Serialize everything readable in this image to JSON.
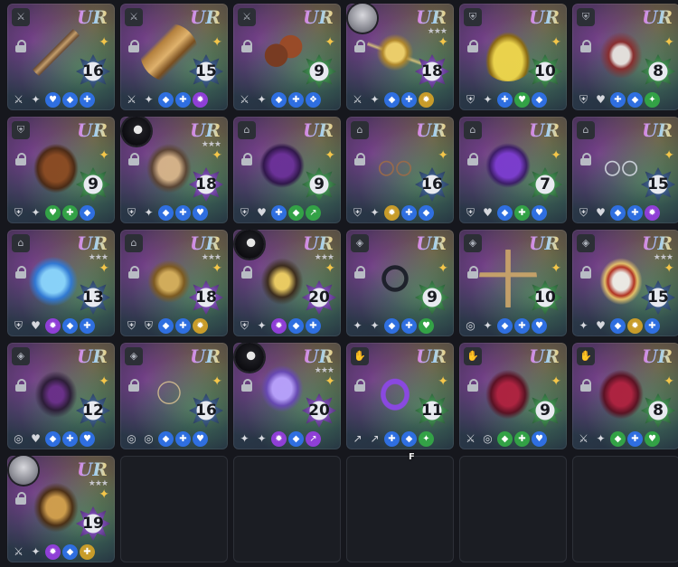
{
  "grade_label": "UR",
  "marker_label": "F",
  "rows": [
    [
      {
        "type_icon": "sword-icon",
        "avatar": null,
        "level": 16,
        "stars": "",
        "art": "art-staff",
        "badge": "blue",
        "stats": [
          [
            "plain",
            "⚔"
          ],
          [
            "plain",
            "✦"
          ],
          [
            "blue",
            "♥"
          ],
          [
            "blue",
            "◆"
          ],
          [
            "blue",
            "✚"
          ]
        ]
      },
      {
        "type_icon": "sword-icon",
        "avatar": null,
        "level": 15,
        "stars": "",
        "art": "art-crystal",
        "badge": "blue",
        "stats": [
          [
            "plain",
            "⚔"
          ],
          [
            "plain",
            "✦"
          ],
          [
            "blue",
            "◆"
          ],
          [
            "blue",
            "✚"
          ],
          [
            "purple",
            "✹"
          ]
        ]
      },
      {
        "type_icon": "sword-icon",
        "avatar": null,
        "level": 9,
        "stars": "",
        "art": "art-gloves",
        "badge": "green",
        "stats": [
          [
            "plain",
            "⚔"
          ],
          [
            "plain",
            "✦"
          ],
          [
            "blue",
            "◆"
          ],
          [
            "blue",
            "✚"
          ],
          [
            "blue",
            "❖"
          ]
        ]
      },
      {
        "type_icon": "sword-icon",
        "avatar": "light",
        "level": 18,
        "stars": "★★★",
        "art": "art-gold",
        "badge": "purple",
        "stats": [
          [
            "plain",
            "⚔"
          ],
          [
            "plain",
            "✦"
          ],
          [
            "blue",
            "◆"
          ],
          [
            "blue",
            "✚"
          ],
          [
            "gold",
            "✹"
          ]
        ]
      },
      {
        "type_icon": "armor-icon",
        "avatar": null,
        "level": 10,
        "stars": "",
        "art": "art-bell",
        "badge": "green",
        "stats": [
          [
            "plain",
            "⛨"
          ],
          [
            "plain",
            "✦"
          ],
          [
            "blue",
            "✚"
          ],
          [
            "green",
            "♥"
          ],
          [
            "blue",
            "◆"
          ]
        ]
      },
      {
        "type_icon": "armor-icon",
        "avatar": null,
        "level": 8,
        "stars": "",
        "art": "art-armor-w",
        "badge": "green",
        "stats": [
          [
            "plain",
            "⛨"
          ],
          [
            "plain",
            "♥"
          ],
          [
            "blue",
            "✚"
          ],
          [
            "blue",
            "◆"
          ],
          [
            "green",
            "✦"
          ]
        ]
      }
    ],
    [
      {
        "type_icon": "armor-icon",
        "avatar": null,
        "level": 9,
        "stars": "",
        "art": "art-armor-b",
        "badge": "green",
        "stats": [
          [
            "plain",
            "⛨"
          ],
          [
            "plain",
            "✦"
          ],
          [
            "green",
            "♥"
          ],
          [
            "green",
            "✚"
          ],
          [
            "blue",
            "◆"
          ]
        ]
      },
      {
        "type_icon": "armor-icon",
        "avatar": "dark",
        "level": 18,
        "stars": "★★★",
        "art": "art-armor-g",
        "badge": "purple",
        "stats": [
          [
            "plain",
            "⛨"
          ],
          [
            "plain",
            "✦"
          ],
          [
            "blue",
            "◆"
          ],
          [
            "blue",
            "✚"
          ],
          [
            "blue",
            "♥"
          ]
        ]
      },
      {
        "type_icon": "helmet-icon",
        "avatar": null,
        "level": 9,
        "stars": "",
        "art": "art-ribbon",
        "badge": "green",
        "stats": [
          [
            "plain",
            "⛨"
          ],
          [
            "plain",
            "♥"
          ],
          [
            "blue",
            "✚"
          ],
          [
            "green",
            "◆"
          ],
          [
            "green",
            "↗"
          ]
        ]
      },
      {
        "type_icon": "helmet-icon",
        "avatar": null,
        "level": 16,
        "stars": "",
        "art": "art-glasses",
        "badge": "blue",
        "stats": [
          [
            "plain",
            "⛨"
          ],
          [
            "plain",
            "✦"
          ],
          [
            "gold",
            "✹"
          ],
          [
            "blue",
            "✚"
          ],
          [
            "blue",
            "◆"
          ]
        ]
      },
      {
        "type_icon": "helmet-icon",
        "avatar": null,
        "level": 7,
        "stars": "",
        "art": "art-ribbon2",
        "badge": "green",
        "stats": [
          [
            "plain",
            "⛨"
          ],
          [
            "plain",
            "♥"
          ],
          [
            "blue",
            "◆"
          ],
          [
            "green",
            "✚"
          ],
          [
            "blue",
            "♥"
          ]
        ]
      },
      {
        "type_icon": "helmet-icon",
        "avatar": null,
        "level": 15,
        "stars": "",
        "art": "art-glasses2",
        "badge": "blue",
        "stats": [
          [
            "plain",
            "⛨"
          ],
          [
            "plain",
            "♥"
          ],
          [
            "blue",
            "◆"
          ],
          [
            "blue",
            "✚"
          ],
          [
            "purple",
            "✹"
          ]
        ]
      }
    ],
    [
      {
        "type_icon": "helmet-icon",
        "avatar": null,
        "level": 13,
        "stars": "★★★",
        "art": "art-ice",
        "badge": "blue",
        "stats": [
          [
            "plain",
            "⛨"
          ],
          [
            "plain",
            "♥"
          ],
          [
            "purple",
            "✹"
          ],
          [
            "blue",
            "◆"
          ],
          [
            "blue",
            "✚"
          ]
        ]
      },
      {
        "type_icon": "helmet-icon",
        "avatar": null,
        "level": 18,
        "stars": "★★★",
        "art": "art-nest",
        "badge": "purple",
        "stats": [
          [
            "plain",
            "⛨"
          ],
          [
            "plain",
            "⛨"
          ],
          [
            "blue",
            "◆"
          ],
          [
            "blue",
            "✚"
          ],
          [
            "gold",
            "✹"
          ]
        ]
      },
      {
        "type_icon": "helmet-icon",
        "avatar": "dark",
        "level": 20,
        "stars": "★★★",
        "art": "art-helm",
        "badge": "purple",
        "stats": [
          [
            "plain",
            "⛨"
          ],
          [
            "plain",
            "✦"
          ],
          [
            "purple",
            "✹"
          ],
          [
            "blue",
            "◆"
          ],
          [
            "blue",
            "✚"
          ]
        ]
      },
      {
        "type_icon": "gem-icon",
        "avatar": null,
        "level": 9,
        "stars": "",
        "art": "art-collar",
        "badge": "green",
        "stats": [
          [
            "plain",
            "✦"
          ],
          [
            "plain",
            "✦"
          ],
          [
            "blue",
            "◆"
          ],
          [
            "blue",
            "✚"
          ],
          [
            "green",
            "♥"
          ]
        ]
      },
      {
        "type_icon": "gem-icon",
        "avatar": null,
        "level": 10,
        "stars": "",
        "art": "art-cross",
        "badge": "green",
        "stats": [
          [
            "plain",
            "◎"
          ],
          [
            "plain",
            "✦"
          ],
          [
            "blue",
            "◆"
          ],
          [
            "blue",
            "✚"
          ],
          [
            "blue",
            "♥"
          ]
        ]
      },
      {
        "type_icon": "gem-icon",
        "avatar": null,
        "level": 15,
        "stars": "★★★",
        "art": "art-book",
        "badge": "blue",
        "stats": [
          [
            "plain",
            "✦"
          ],
          [
            "plain",
            "♥"
          ],
          [
            "blue",
            "◆"
          ],
          [
            "gold",
            "✹"
          ],
          [
            "blue",
            "✚"
          ]
        ]
      }
    ],
    [
      {
        "type_icon": "gem-icon",
        "avatar": null,
        "level": 12,
        "stars": "",
        "art": "art-bat",
        "badge": "blue",
        "stats": [
          [
            "plain",
            "◎"
          ],
          [
            "plain",
            "♥"
          ],
          [
            "blue",
            "◆"
          ],
          [
            "blue",
            "✚"
          ],
          [
            "blue",
            "♥"
          ]
        ]
      },
      {
        "type_icon": "gem-icon",
        "avatar": null,
        "level": 16,
        "stars": "",
        "art": "art-necklace",
        "badge": "blue",
        "stats": [
          [
            "plain",
            "◎"
          ],
          [
            "plain",
            "◎"
          ],
          [
            "blue",
            "◆"
          ],
          [
            "blue",
            "✚"
          ],
          [
            "blue",
            "♥"
          ]
        ]
      },
      {
        "type_icon": "gem-icon",
        "avatar": "dark",
        "level": 20,
        "stars": "★★★",
        "art": "art-bonnet",
        "badge": "purple",
        "stats": [
          [
            "plain",
            "✦"
          ],
          [
            "plain",
            "✦"
          ],
          [
            "purple",
            "✹"
          ],
          [
            "blue",
            "◆"
          ],
          [
            "purple",
            "↗"
          ]
        ]
      },
      {
        "type_icon": "glove-icon",
        "avatar": null,
        "level": 11,
        "stars": "",
        "art": "art-band",
        "badge": "green",
        "stats": [
          [
            "plain",
            "↗"
          ],
          [
            "plain",
            "↗"
          ],
          [
            "blue",
            "✚"
          ],
          [
            "blue",
            "◆"
          ],
          [
            "green",
            "✦"
          ]
        ]
      },
      {
        "type_icon": "glove-icon",
        "avatar": null,
        "level": 9,
        "stars": "",
        "art": "art-glove-r",
        "badge": "green",
        "stats": [
          [
            "plain",
            "⚔"
          ],
          [
            "plain",
            "◎"
          ],
          [
            "green",
            "◆"
          ],
          [
            "green",
            "✚"
          ],
          [
            "blue",
            "♥"
          ]
        ]
      },
      {
        "type_icon": "glove-icon",
        "avatar": null,
        "level": 8,
        "stars": "",
        "art": "art-glove-r",
        "badge": "green",
        "stats": [
          [
            "plain",
            "⚔"
          ],
          [
            "plain",
            "✦"
          ],
          [
            "green",
            "◆"
          ],
          [
            "blue",
            "✚"
          ],
          [
            "green",
            "♥"
          ]
        ]
      }
    ],
    [
      {
        "type_icon": "glove-icon",
        "avatar": "light",
        "level": 19,
        "stars": "★★★",
        "art": "art-gauntlet",
        "badge": "purple",
        "stats": [
          [
            "plain",
            "⚔"
          ],
          [
            "plain",
            "✦"
          ],
          [
            "purple",
            "✹"
          ],
          [
            "blue",
            "◆"
          ],
          [
            "gold",
            "✚"
          ]
        ]
      },
      null,
      null,
      null,
      null,
      null
    ]
  ],
  "colors": {
    "background": "#16171d",
    "empty_slot": "#1b1d23",
    "grade_gradient": [
      "#e07ad9",
      "#9bd0ff",
      "#f3d17a"
    ],
    "star_accent": "#f4c64a"
  }
}
